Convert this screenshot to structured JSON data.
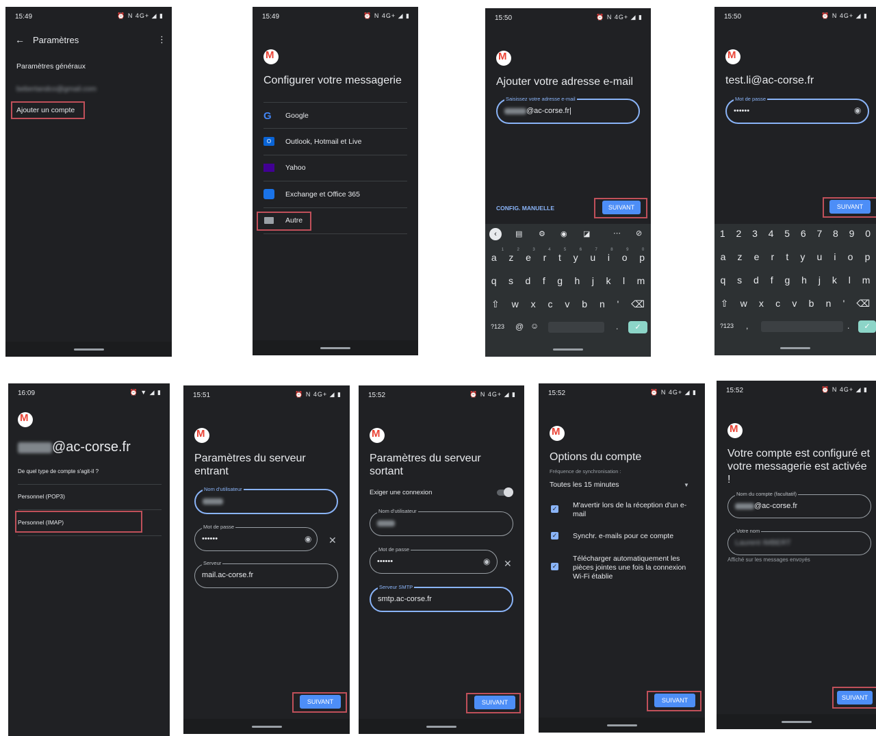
{
  "screens": {
    "s1": {
      "time": "15:49",
      "status_icons": "⏰ N 4G+ ◢ ▮",
      "title": "Paramètres",
      "general": "Paramètres généraux",
      "account": "bebertandco@gmail.com",
      "add": "Ajouter un compte"
    },
    "s2": {
      "time": "15:49",
      "status_icons": "⏰ N 4G+ ◢ ▮",
      "title": "Configurer votre messagerie",
      "providers": [
        "Google",
        "Outlook, Hotmail et Live",
        "Yahoo",
        "Exchange et Office 365",
        "Autre"
      ]
    },
    "s3": {
      "time": "15:50",
      "status_icons": "⏰ N 4G+ ◢ ▮",
      "title": "Ajouter votre adresse e-mail",
      "field_label": "Saisissez votre adresse e-mail",
      "email_suffix": "@ac-corse.fr",
      "manual": "CONFIG. MANUELLE",
      "next": "SUIVANT",
      "kb_row1": [
        "a",
        "z",
        "e",
        "r",
        "t",
        "y",
        "u",
        "i",
        "o",
        "p"
      ],
      "kb_hints": [
        "1",
        "2",
        "3",
        "4",
        "5",
        "6",
        "7",
        "8",
        "9",
        "0"
      ],
      "kb_row2": [
        "q",
        "s",
        "d",
        "f",
        "g",
        "h",
        "j",
        "k",
        "l",
        "m"
      ],
      "kb_row3": [
        "w",
        "x",
        "c",
        "v",
        "b",
        "n",
        "'"
      ],
      "kb_sym": "?123",
      "kb_at": "@"
    },
    "s4": {
      "time": "15:50",
      "status_icons": "⏰ N 4G+ ◢ ▮",
      "email": "test.li@ac-corse.fr",
      "field_label": "Mot de passe",
      "password": "••••••",
      "next": "SUIVANT",
      "kb_nums": [
        "1",
        "2",
        "3",
        "4",
        "5",
        "6",
        "7",
        "8",
        "9",
        "0"
      ],
      "kb_row1": [
        "a",
        "z",
        "e",
        "r",
        "t",
        "y",
        "u",
        "i",
        "o",
        "p"
      ],
      "kb_row2": [
        "q",
        "s",
        "d",
        "f",
        "g",
        "h",
        "j",
        "k",
        "l",
        "m"
      ],
      "kb_row3": [
        "w",
        "x",
        "c",
        "v",
        "b",
        "n",
        "'"
      ],
      "kb_sym": "?123",
      "kb_comma": ","
    },
    "s5": {
      "time": "16:09",
      "status_icons": "⏰ ▼ ◢ ▮",
      "email_suffix": "@ac-corse.fr",
      "question": "De quel type de compte s'agit-il ?",
      "pop3": "Personnel (POP3)",
      "imap": "Personnel (IMAP)"
    },
    "s6": {
      "time": "15:51",
      "status_icons": "⏰ N 4G+ ◢ ▮",
      "title": "Paramètres du serveur entrant",
      "user_label": "Nom d'utilisateur",
      "pass_label": "Mot de passe",
      "password": "••••••",
      "server_label": "Serveur",
      "server": "mail.ac-corse.fr",
      "next": "SUIVANT"
    },
    "s7": {
      "time": "15:52",
      "status_icons": "⏰ N 4G+ ◢ ▮",
      "title": "Paramètres du serveur sortant",
      "require": "Exiger une connexion",
      "user_label": "Nom d'utilisateur",
      "pass_label": "Mot de passe",
      "password": "••••••",
      "server_label": "Serveur SMTP",
      "server": "smtp.ac-corse.fr",
      "next": "SUIVANT"
    },
    "s8": {
      "time": "15:52",
      "status_icons": "⏰ N 4G+ ◢ ▮",
      "title": "Options du compte",
      "freq_label": "Fréquence de synchronisation :",
      "freq": "Toutes les 15 minutes",
      "opt1": "M'avertir lors de la réception d'un e-mail",
      "opt2": "Synchr. e-mails pour ce compte",
      "opt3": "Télécharger automatiquement les pièces jointes une fois la connexion Wi-Fi établie",
      "next": "SUIVANT"
    },
    "s9": {
      "time": "15:52",
      "status_icons": "⏰ N 4G+ ◢ ▮",
      "title": "Votre compte est configuré et votre messagerie est activée !",
      "acct_label": "Nom du compte (facultatif)",
      "email_suffix": "@ac-corse.fr",
      "name_label": "Votre nom",
      "name": "Laurent IMBERT",
      "hint": "Affiché sur les messages envoyés",
      "next": "SUIVANT"
    }
  }
}
